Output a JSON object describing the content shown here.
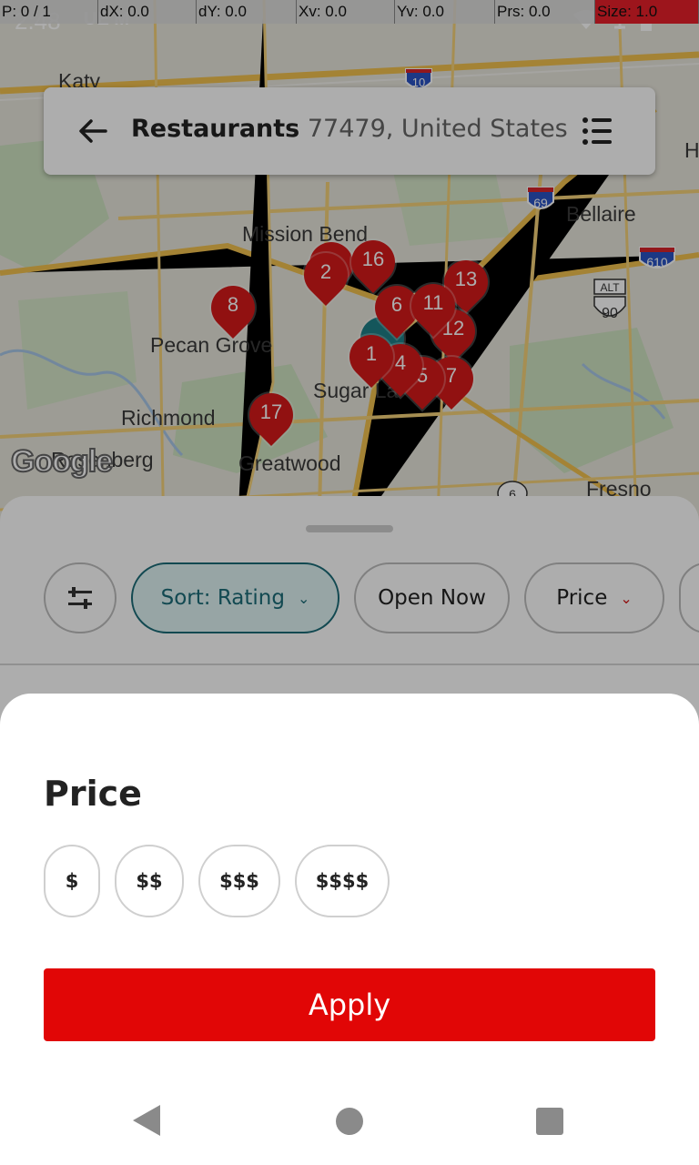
{
  "status_bar": {
    "time": "2:48",
    "left_icons": "UE M",
    "right_icons": "wifi airplane battery",
    "debug": {
      "p": "P: 0 / 1",
      "dx": "dX: 0.0",
      "dy": "dY: 0.0",
      "xv": "Xv: 0.0",
      "yv": "Yv: 0.0",
      "prs": "Prs: 0.0",
      "size": "Size: 1.0"
    }
  },
  "search": {
    "query": "Restaurants",
    "location": "77479, United States"
  },
  "map": {
    "labels": {
      "katy": "Katy",
      "mission_bend": "Mission Bend",
      "bellaire": "Bellaire",
      "pecan_grove": "Pecan Grove",
      "sugar_land": "Sugar La",
      "richmond": "Richmond",
      "rosenberg": "Rosenberg",
      "greatwood": "Greatwood",
      "fresno": "Fresno",
      "h": "H"
    },
    "shields": {
      "i10": "10",
      "i69": "69",
      "i610": "610",
      "us90": "90",
      "alt": "ALT",
      "r6": "6"
    },
    "markers": [
      "2",
      "16",
      "8",
      "13",
      "6",
      "11",
      "12",
      "1",
      "4",
      "5",
      "7",
      "17"
    ],
    "logo": "Google"
  },
  "filters": {
    "sort": "Sort: Rating",
    "open_now": "Open Now",
    "price": "Price"
  },
  "price_sheet": {
    "title": "Price",
    "options": [
      "$",
      "$$",
      "$$$",
      "$$$$"
    ],
    "apply": "Apply"
  },
  "colors": {
    "accent_red": "#e10606",
    "marker_red": "#d61a1a",
    "sort_teal": "#1b6c78"
  }
}
